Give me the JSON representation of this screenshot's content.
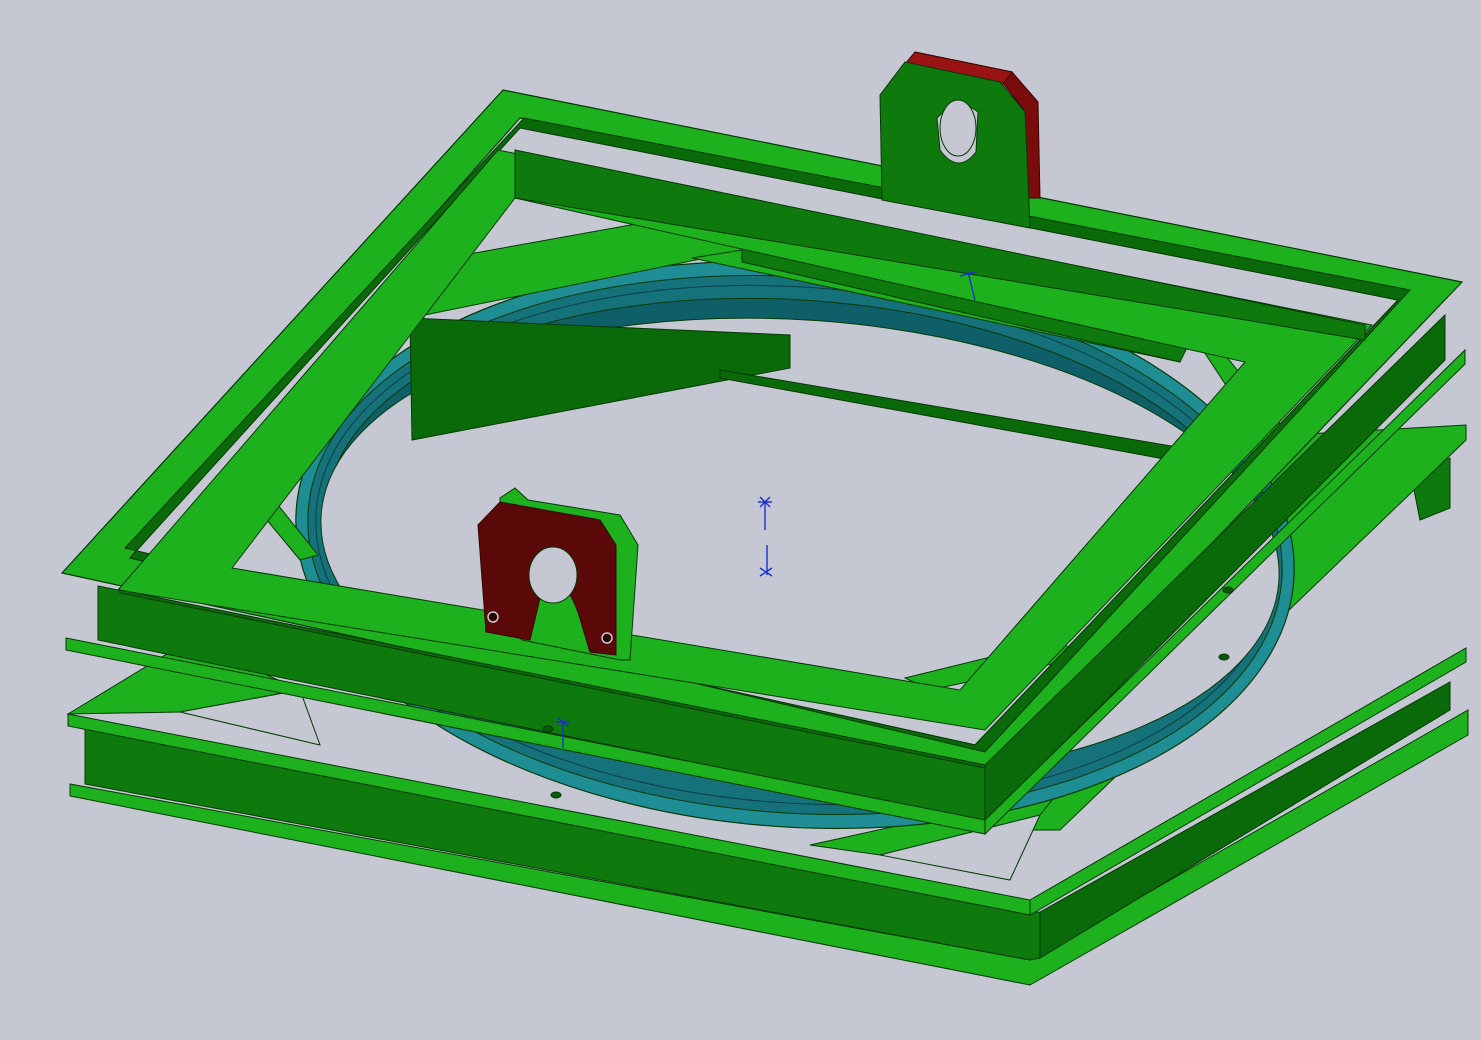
{
  "scene": {
    "background": "#c5c8d2",
    "colors": {
      "frame_top": "#1db11d",
      "frame_side": "#0e7a0e",
      "frame_dark": "#0a6a0a",
      "edge": "#063806",
      "ring_face": "#1f8d94",
      "ring_inner": "#0f5f68",
      "lug_face": "#7a0c0c",
      "lug_top": "#9a1414",
      "triad": "#1a2fd0"
    },
    "parts": [
      {
        "name": "upper-square-frame"
      },
      {
        "name": "lower-square-frame"
      },
      {
        "name": "bearing-ring"
      },
      {
        "name": "lifting-lug-front"
      },
      {
        "name": "lifting-lug-back"
      },
      {
        "name": "diagonal-braces"
      }
    ],
    "annotations": [
      "origin-triad",
      "sketch-point-markers"
    ]
  }
}
